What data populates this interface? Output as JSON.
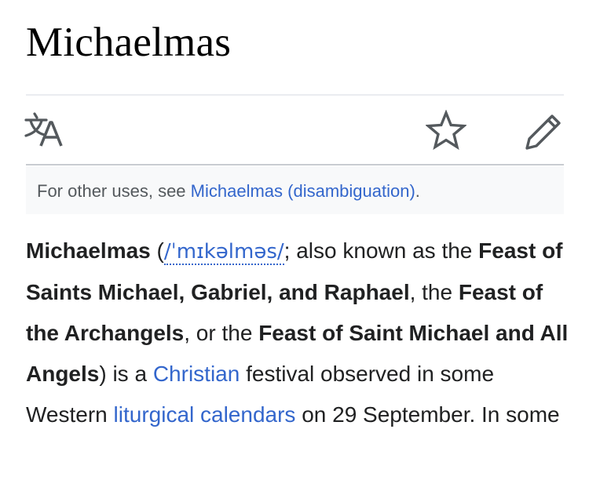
{
  "page": {
    "title": "Michaelmas"
  },
  "toolbar": {
    "language_icon": "language-icon",
    "watch_icon": "star-icon",
    "edit_icon": "pencil-icon"
  },
  "hatnote": {
    "prefix": "For other uses, see ",
    "link_text": "Michaelmas (disambiguation)",
    "suffix": "."
  },
  "intro": {
    "term": "Michaelmas",
    "paren_open": " (",
    "ipa": "/ˈmɪkəlməs/",
    "after_ipa": "; also known as the ",
    "alt_name_1": "Feast of Saints Michael, Gabriel, and Raphael",
    "sep_1": ", the ",
    "alt_name_2": "Feast of the Archangels",
    "sep_2": ", or the ",
    "alt_name_3": "Feast of Saint Michael and All Angels",
    "after_names": ") is a ",
    "link_christian": "Christian",
    "text_1": " festival observed in some Western ",
    "link_calendars": "liturgical calendars",
    "text_2": " on 29 September. In some"
  },
  "colors": {
    "link": "#3366cc",
    "text": "#202122",
    "hatnote_bg": "#f8f9fa",
    "hatnote_text": "#54595d",
    "rule": "#c8ccd1"
  }
}
